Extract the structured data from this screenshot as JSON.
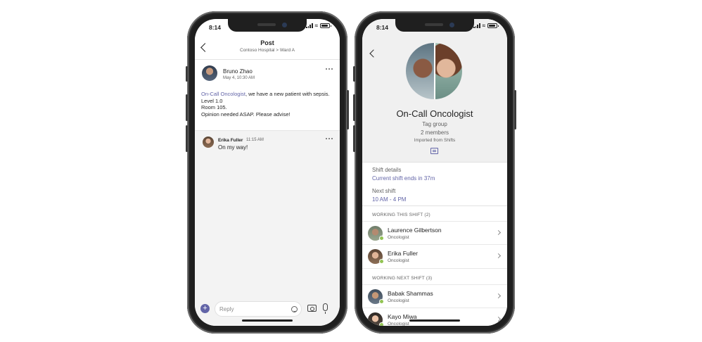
{
  "status_bar": {
    "time": "8:14"
  },
  "post_screen": {
    "title": "Post",
    "breadcrumb": "Contoso Hospital > Ward A",
    "post": {
      "author": "Bruno Zhao",
      "timestamp": "May 4, 10:30 AM",
      "mention": "On-Call Oncologist",
      "line1": ", we have a new patient with sepsis.",
      "line2": "Level 1.0",
      "line3": "Room 105.",
      "line4": "Opinion needed ASAP. Please advise!"
    },
    "reply": {
      "author": "Erika Fuller",
      "timestamp": "11:15 AM",
      "text": "On my way!"
    },
    "composer": {
      "placeholder": "Reply"
    }
  },
  "profile_screen": {
    "name": "On-Call Oncologist",
    "type": "Tag group",
    "members": "2 members",
    "source": "Imported from Shifts",
    "shift_details_label": "Shift details",
    "shift_details_value": "Current shift ends in 37m",
    "next_shift_label": "Next shift",
    "next_shift_value": "10 AM - 4 PM",
    "working_this_shift_header": "WORKING THIS SHIFT (2)",
    "working_this_shift": [
      {
        "name": "Laurence Gilbertson",
        "role": "Oncologist"
      },
      {
        "name": "Erika Fuller",
        "role": "Oncologist"
      }
    ],
    "working_next_shift_header": "WORKING NEXT SHIFT (3)",
    "working_next_shift": [
      {
        "name": "Babak Shammas",
        "role": "Oncologist"
      },
      {
        "name": "Kayo Miwa",
        "role": "Oncologist"
      }
    ]
  },
  "colors": {
    "accent": "#6264a7",
    "presence_available": "#92c353"
  }
}
